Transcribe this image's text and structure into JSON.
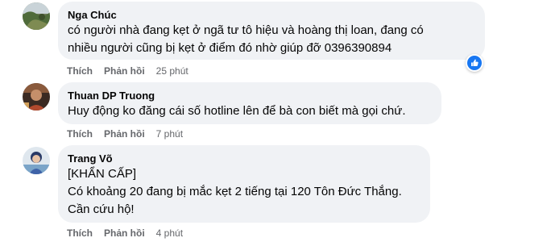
{
  "comments": [
    {
      "author": "Nga Chúc",
      "lines": [
        "có người nhà đang kẹt ở ngã tư tô hiệu và hoàng thị loan, đang có",
        "nhiều người cũng bị kẹt ở điểm đó nhờ giúp đỡ 0396390894"
      ],
      "like_label": "Thích",
      "reply_label": "Phản hồi",
      "time": "25 phút",
      "reaction": "like-icon"
    },
    {
      "author": "Thuan DP Truong",
      "lines": [
        "Huy động ko đăng cái số hotline lên để bà con biết mà gọi chứ."
      ],
      "like_label": "Thích",
      "reply_label": "Phản hồi",
      "time": "7 phút"
    },
    {
      "author": "Trang Võ",
      "lines": [
        "[KHẨN CẤP]",
        "Có khoảng 20 đang bị mắc kẹt 2 tiếng tại 120 Tôn Đức Thắng.",
        "Cần cứu hộ!"
      ],
      "like_label": "Thích",
      "reply_label": "Phản hồi",
      "time": "4 phút"
    }
  ],
  "colors": {
    "bubble_bg": "#f0f2f5",
    "text": "#050505",
    "secondary_text": "#65676b",
    "like_blue": "#1877f2"
  }
}
